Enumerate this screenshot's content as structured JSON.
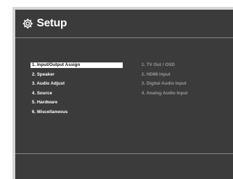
{
  "header": {
    "icon": "gear-icon",
    "title": "Setup"
  },
  "menu": {
    "items": [
      {
        "label": "1. Input/Output Assign",
        "selected": true
      },
      {
        "label": "2. Speaker",
        "selected": false
      },
      {
        "label": "3. Audio Adjust",
        "selected": false
      },
      {
        "label": "4. Source",
        "selected": false
      },
      {
        "label": "5. Hardware",
        "selected": false
      },
      {
        "label": "6. Miscellaneous",
        "selected": false
      }
    ]
  },
  "submenu": {
    "items": [
      {
        "label": "1. TV Out / OSD"
      },
      {
        "label": "2. HDMI Input"
      },
      {
        "label": "3. Digital Audio Input"
      },
      {
        "label": "4. Analog Audio Input"
      }
    ]
  },
  "colors": {
    "background": "#3b3b3b",
    "frame": "#d6d6d6",
    "text_primary": "#ffffff",
    "text_dimmed": "#9a9a9a",
    "selection_bg": "#ffffff",
    "selection_text": "#111111"
  }
}
